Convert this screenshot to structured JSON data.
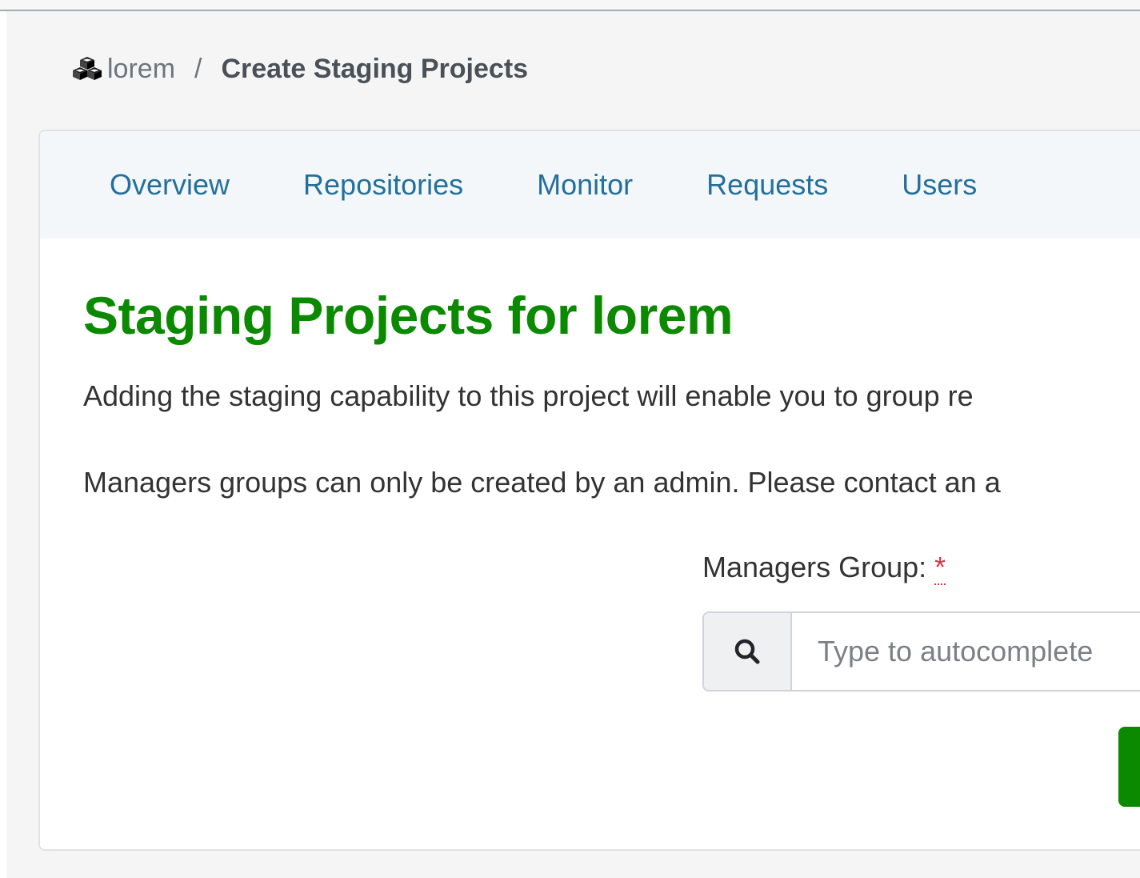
{
  "breadcrumb": {
    "icon": "cubes-icon",
    "project": "lorem",
    "separator": "/",
    "current": "Create Staging Projects"
  },
  "tabs": [
    {
      "label": "Overview"
    },
    {
      "label": "Repositories"
    },
    {
      "label": "Monitor"
    },
    {
      "label": "Requests"
    },
    {
      "label": "Users"
    }
  ],
  "main": {
    "title": "Staging Projects for lorem",
    "paragraph_1": "Adding the staging capability to this project will enable you to group re",
    "paragraph_2": "Managers groups can only be created by an admin. Please contact an a"
  },
  "form": {
    "managers_group_label": "Managers Group:",
    "required_mark": "*",
    "search_icon": "search-icon",
    "managers_group_placeholder": "Type to autocomplete",
    "managers_group_value": ""
  },
  "colors": {
    "title_green": "#0b8a00",
    "tab_link_blue": "#24709c",
    "required_red": "#d9363e",
    "header_bg": "#f4f7f9"
  }
}
